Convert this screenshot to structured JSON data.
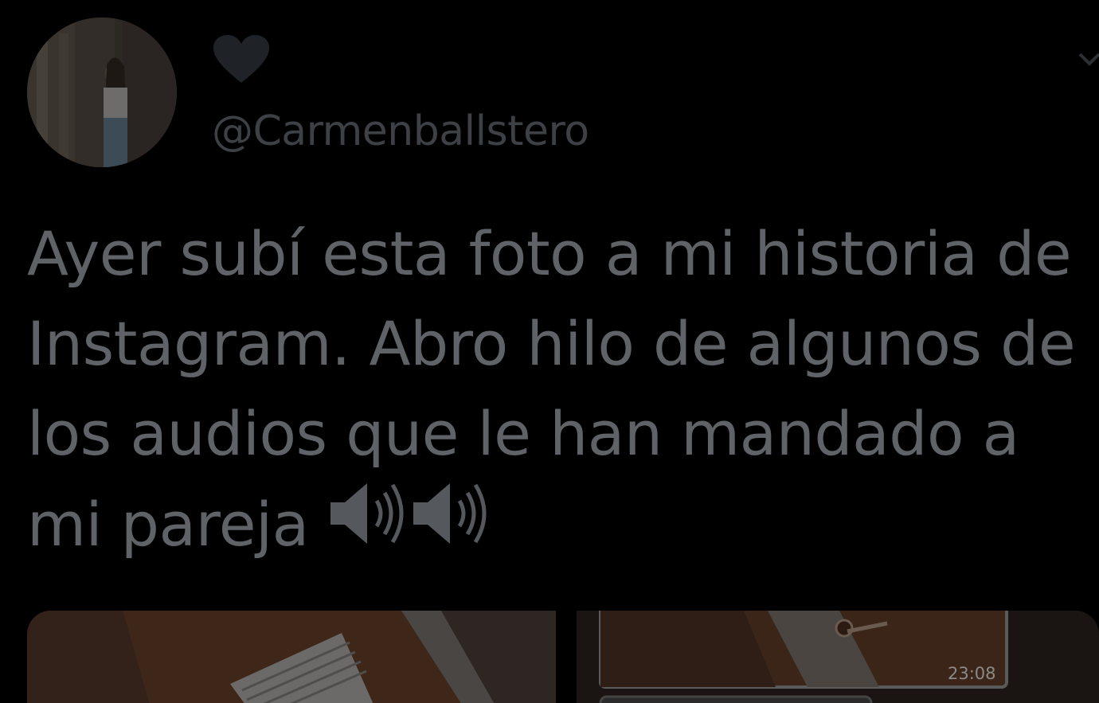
{
  "tweet": {
    "author_handle": "@Carmenballstero",
    "text": "Ayer subí esta foto a mi historia de Instagram. Abro hilo de algunos de los audios que le han mandado a mi pareja",
    "emoji": [
      "speaker-high-volume",
      "speaker-high-volume"
    ],
    "header_icon": "heart-icon",
    "menu_icon": "chevron-down-icon"
  },
  "media": {
    "images": [
      "photo-left",
      "chat-screenshot-right"
    ],
    "timestamp": "23:08"
  },
  "colors": {
    "background": "#000000",
    "text": "#5f6266",
    "handle": "#3d4045"
  }
}
